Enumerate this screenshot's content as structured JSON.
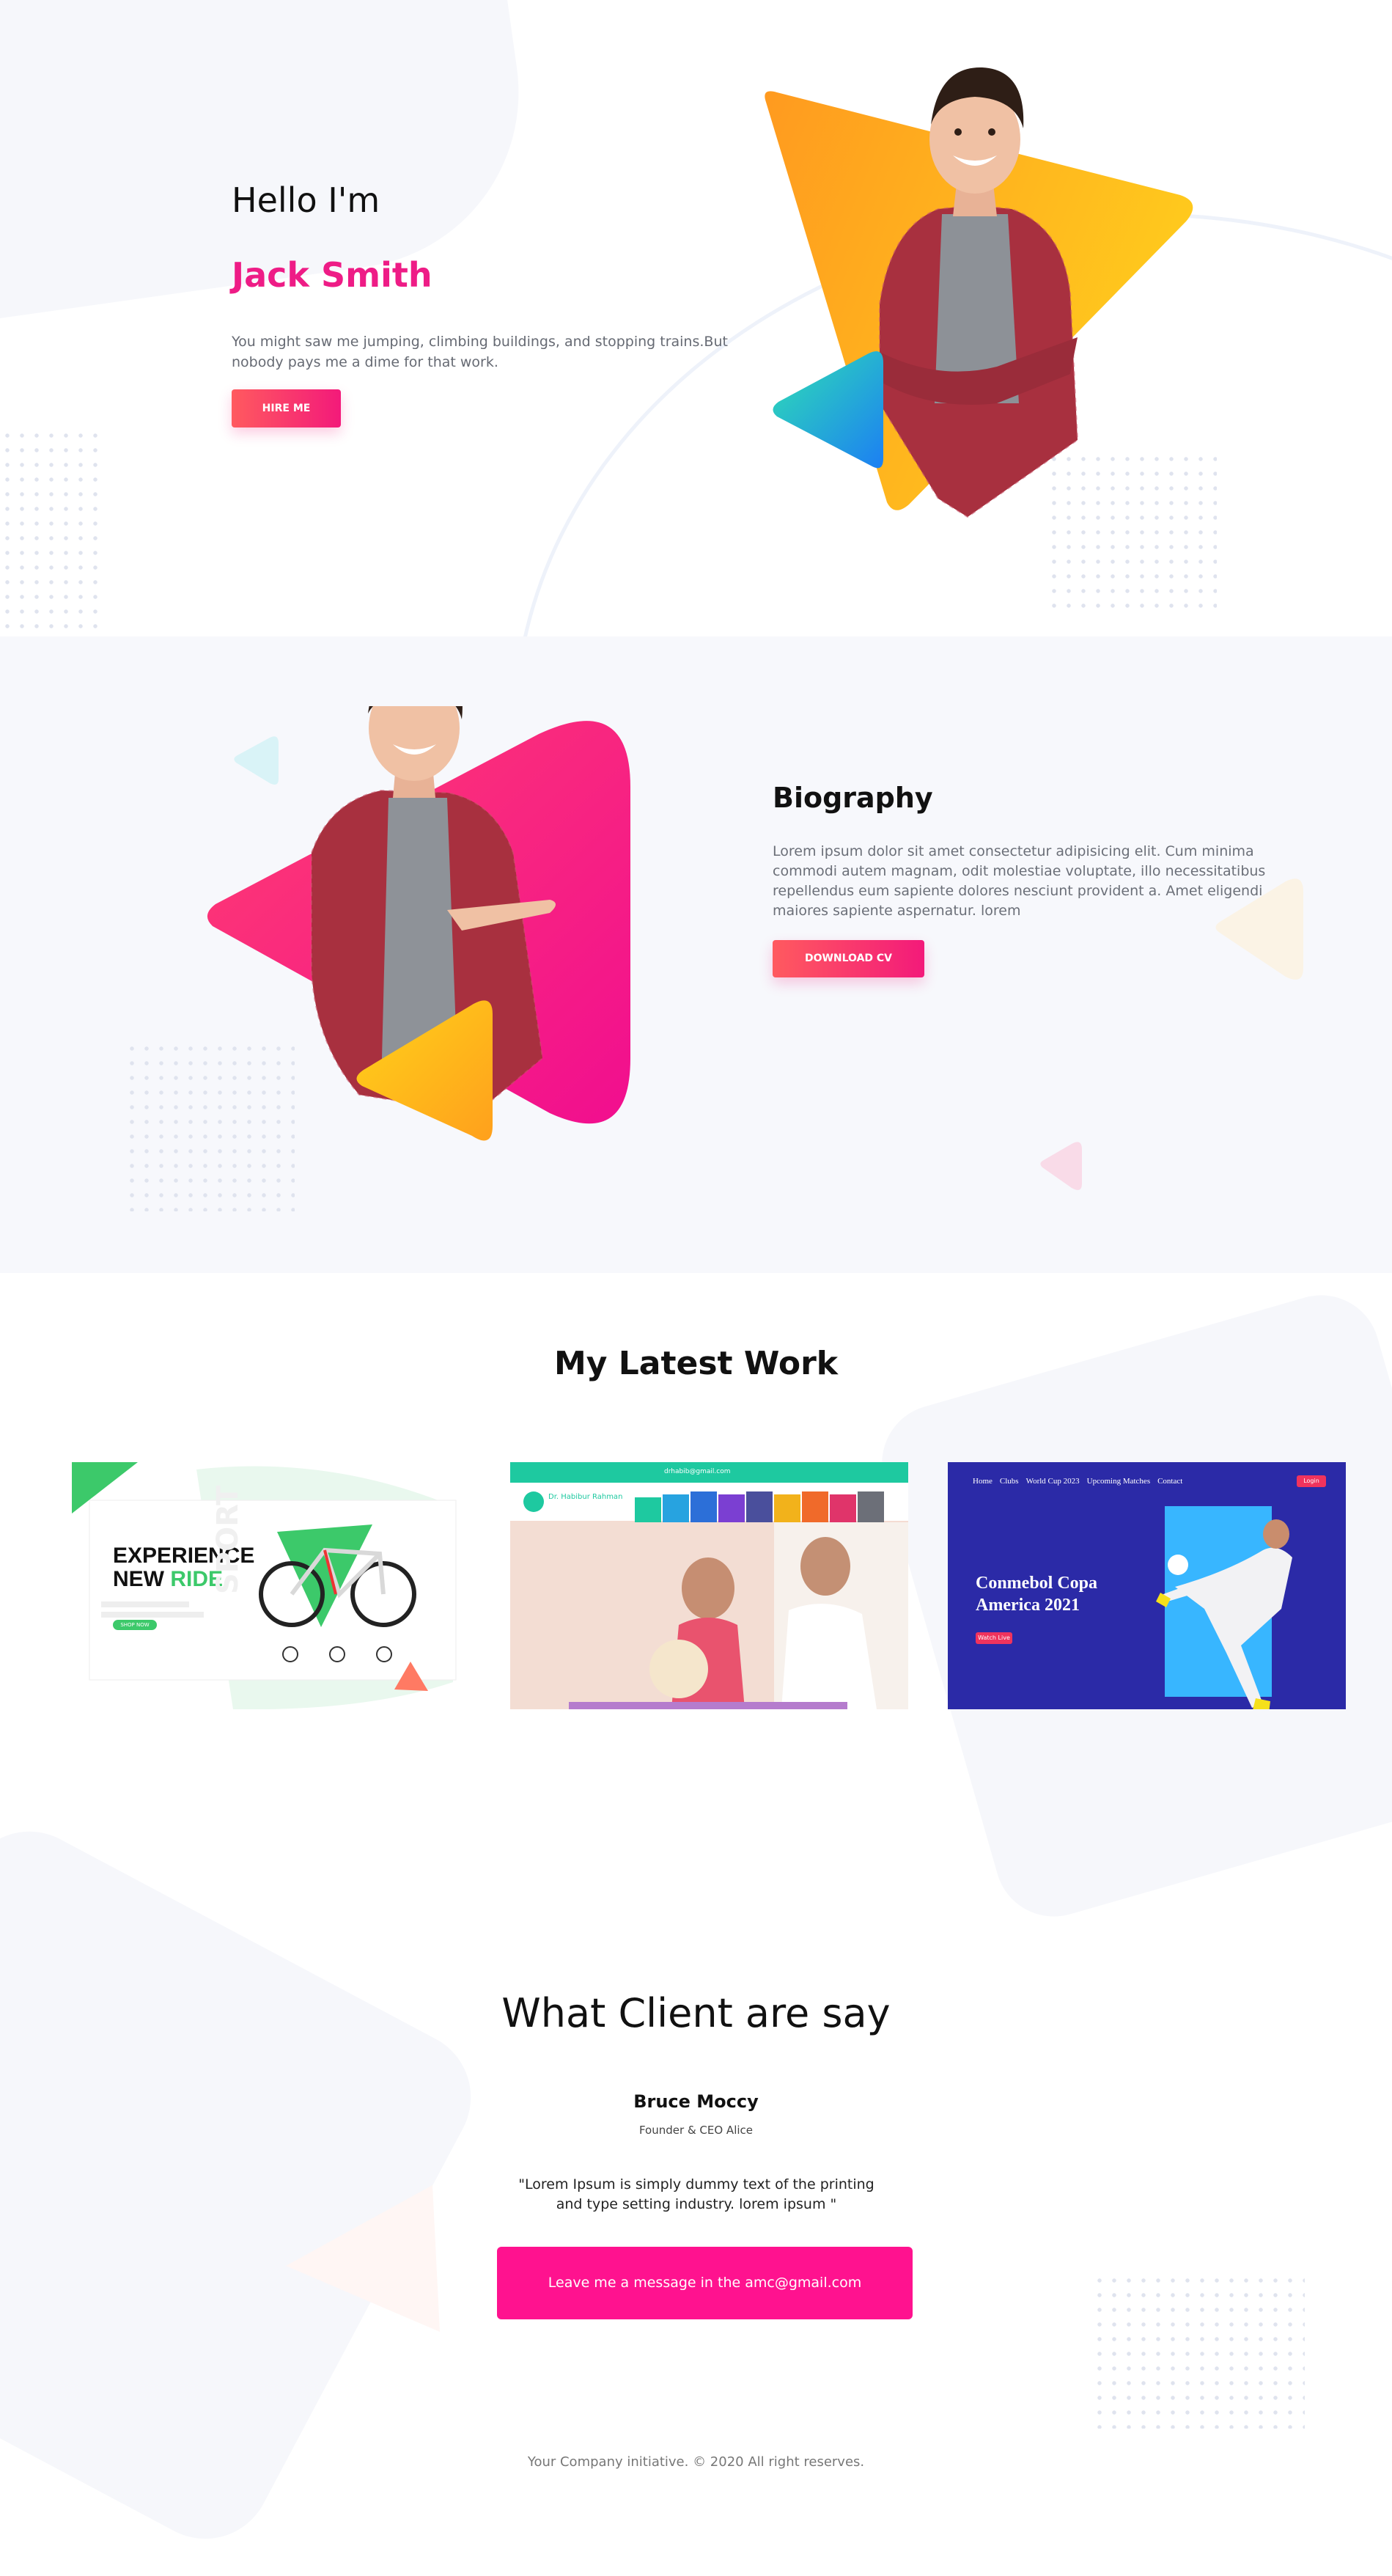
{
  "hero": {
    "greeting": "Hello I'm",
    "name": "Jack Smith",
    "description": "You might saw me jumping, climbing buildings, and stopping trains.But nobody pays me a dime for that work.",
    "button_label": "HIRE ME"
  },
  "biography": {
    "title": "Biography",
    "text": "Lorem ipsum dolor sit amet consectetur adipisicing elit. Cum minima commodi autem magnam, odit molestiae voluptate, illo necessitatibus repellendus eum sapiente dolores nesciunt provident a. Amet eligendi maiores sapiente aspernatur. lorem",
    "button_label": "DOWNLOAD CV"
  },
  "work": {
    "title": "My Latest Work",
    "cards": [
      {
        "headline_line1": "EXPERIENCE",
        "headline_line2_a": "NEW ",
        "headline_line2_b": "RIDE",
        "watermark": "SPORT",
        "button": "SHOP NOW",
        "accent": "#3cc96a"
      },
      {
        "email": "drhabib@gmail.com",
        "doctor_name": "Dr. Habibur Rahman",
        "accent": "#1ec9a0"
      },
      {
        "nav": [
          "Home",
          "Clubs",
          "World Cup 2023",
          "Upcoming Matches",
          "Contact"
        ],
        "login": "Login",
        "headline": "Conmebol Copa America 2021",
        "button": "Watch Live",
        "accent": "#2b2aa7"
      }
    ]
  },
  "testimonial": {
    "title": "What Client are say",
    "client_name": "Bruce Moccy",
    "client_role": "Founder & CEO Alice",
    "quote": "\"Lorem Ipsum is simply dummy text of the printing and type setting industry. lorem ipsum \"",
    "message_button": "Leave me a message in the amc@gmail.com"
  },
  "footer": {
    "text": "Your Company initiative. © 2020 All right reserves."
  },
  "colors": {
    "brand_pink": "#ee1c86",
    "button_gradient_start": "#ff5a5f",
    "button_gradient_end": "#f31a7a",
    "message_button": "#ff128f"
  }
}
